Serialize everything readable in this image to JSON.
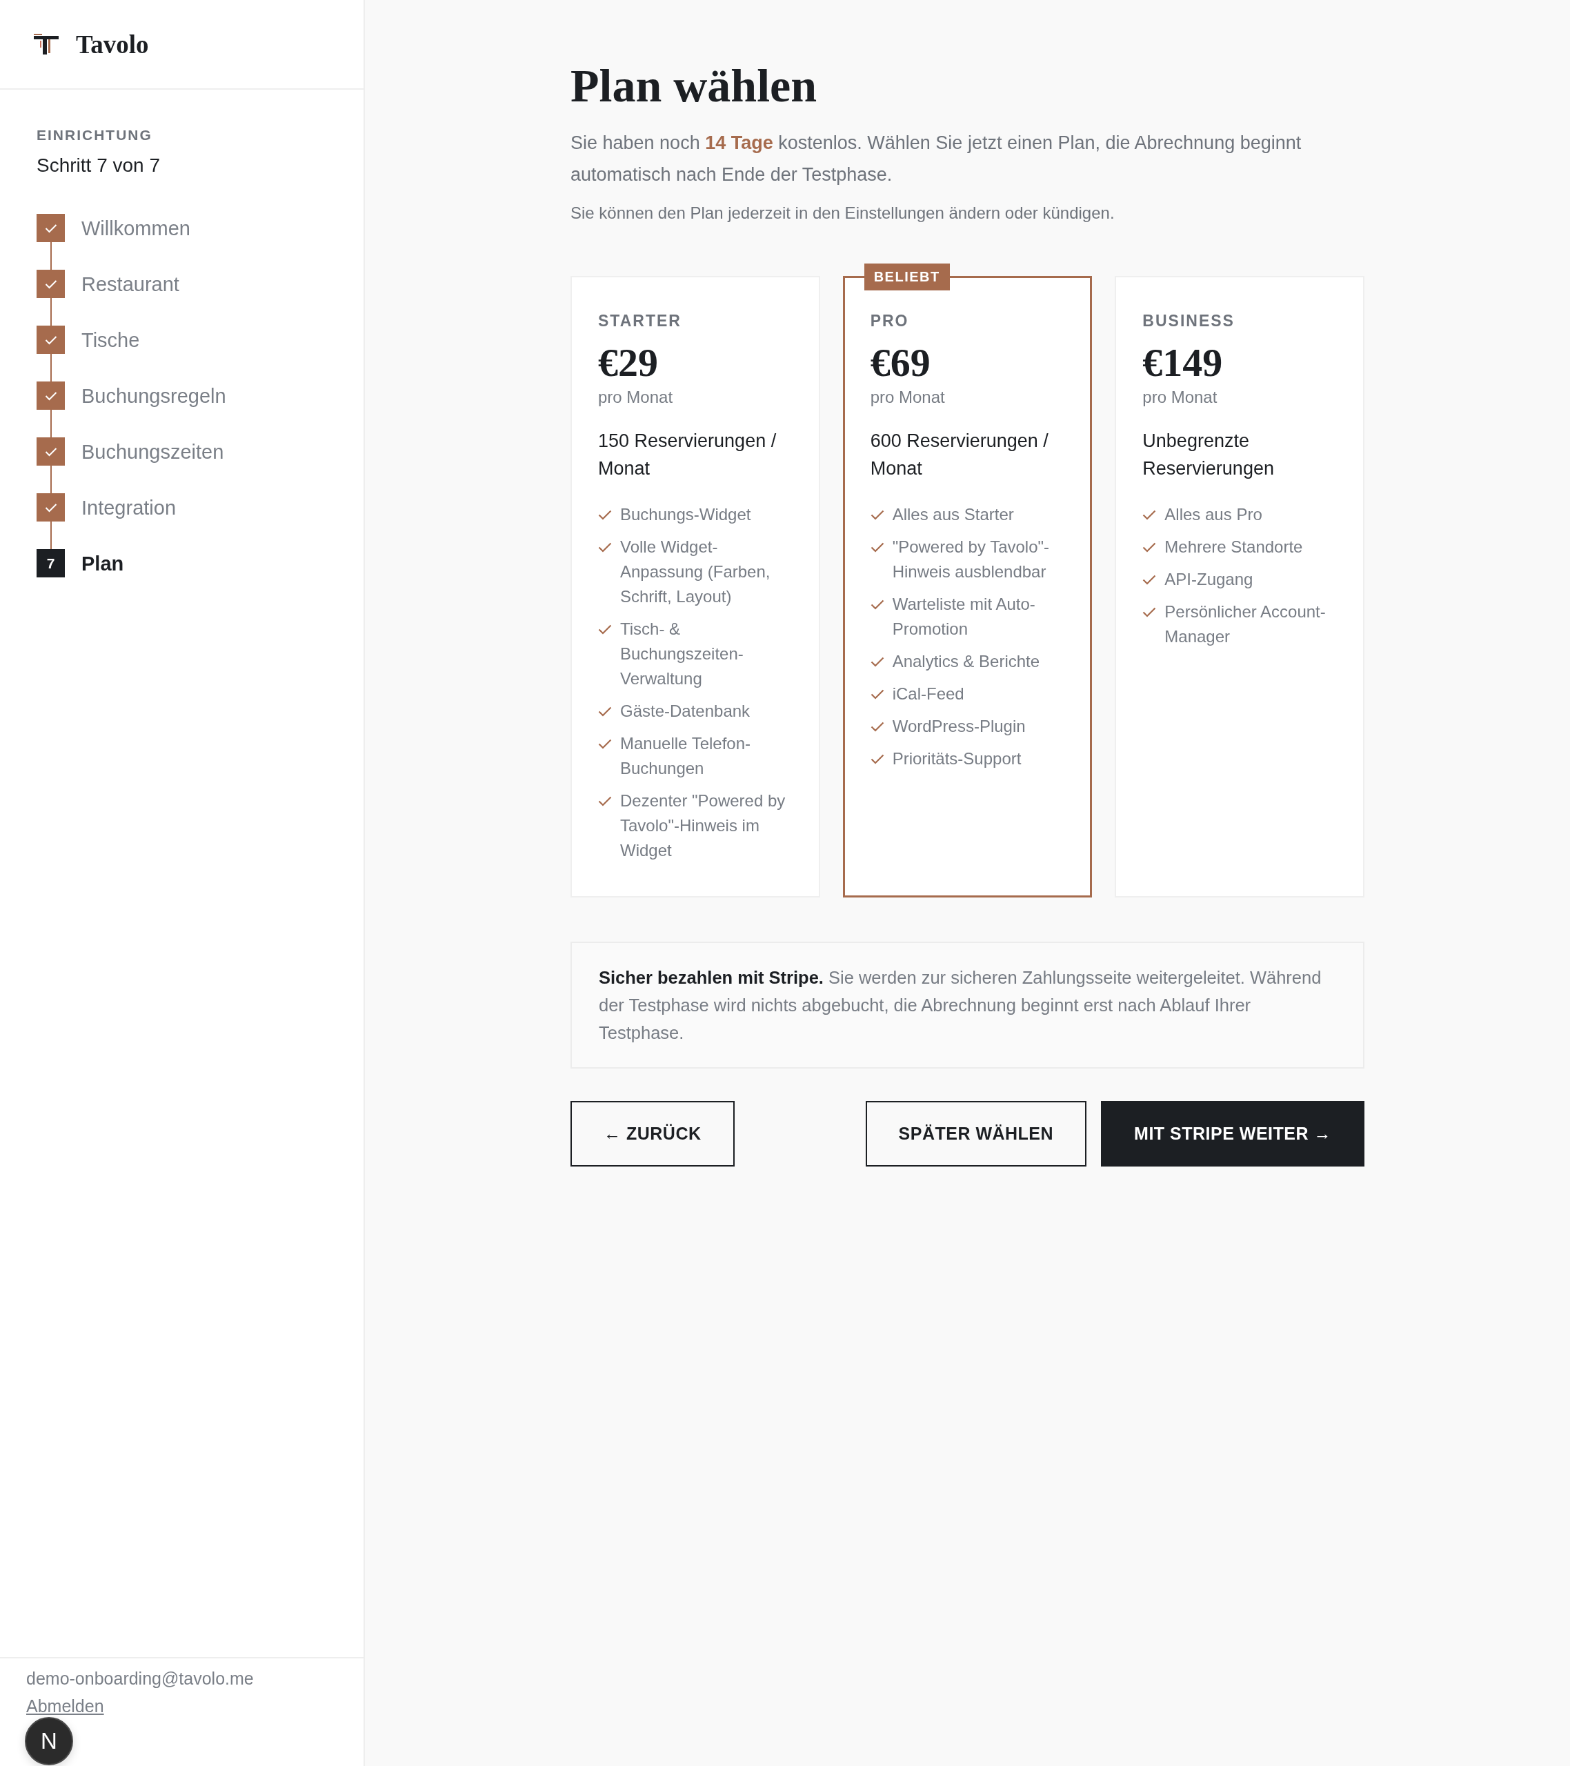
{
  "sidebar": {
    "brand": "Tavolo",
    "section_label": "EINRICHTUNG",
    "progress": "Schritt 7 von 7",
    "steps": [
      {
        "label": "Willkommen",
        "completed": true,
        "selected": false
      },
      {
        "label": "Restaurant",
        "completed": true,
        "selected": false
      },
      {
        "label": "Tische",
        "completed": true,
        "selected": false
      },
      {
        "label": "Buchungsregeln",
        "completed": true,
        "selected": false
      },
      {
        "label": "Buchungszeiten",
        "completed": true,
        "selected": false
      },
      {
        "label": "Integration",
        "completed": true,
        "selected": false
      },
      {
        "label": "Plan",
        "number": "7",
        "completed": false,
        "selected": true
      }
    ],
    "user": {
      "email": "demo-onboarding@tavolo.me",
      "logout": "Abmelden"
    }
  },
  "page": {
    "title": "Plan wählen",
    "intro": "Sie haben noch **14 Tage** kostenlos. Wählen Sie jetzt einen Plan, die Abrechnung beginnt automatisch nach Ende der Testphase.",
    "note": "Sie können den Plan jederzeit in den Einstellungen ändern oder kündigen."
  },
  "plans": [
    {
      "name": "STARTER",
      "price": "€29",
      "period": "pro Monat",
      "quota": "150 Reservierungen / Monat",
      "highlighted": false,
      "features": [
        "Buchungs-Widget",
        "Volle Widget-Anpassung (Farben, Schrift, Layout)",
        "Tisch- & Buchungszeiten-Verwaltung",
        "Gäste-Datenbank",
        "Manuelle Telefon-Buchungen",
        "Dezenter \"Powered by Tavolo\"-Hinweis im Widget"
      ]
    },
    {
      "name": "PRO",
      "price": "€69",
      "period": "pro Monat",
      "quota": "600 Reservierungen / Monat",
      "highlighted": true,
      "badge": "BELIEBT",
      "features": [
        "Alles aus Starter",
        "\"Powered by Tavolo\"-Hinweis ausblendbar",
        "Warteliste mit Auto-Promotion",
        "Analytics & Berichte",
        "iCal-Feed",
        "WordPress-Plugin",
        "Prioritäts-Support"
      ]
    },
    {
      "name": "BUSINESS",
      "price": "€149",
      "period": "pro Monat",
      "quota": "Unbegrenzte Reservierungen",
      "highlighted": false,
      "features": [
        "Alles aus Pro",
        "Mehrere Standorte",
        "API-Zugang",
        "Persönlicher Account-Manager"
      ]
    }
  ],
  "payment_notice": "**Sicher bezahlen mit Stripe.** Sie werden zur sicheren Zahlungsseite weitergeleitet. Während der Testphase wird nichts abgebucht, die Abrechnung beginnt erst nach Ablauf Ihrer Testphase.",
  "buttons": [
    {
      "label": "← ZURÜCK",
      "kind": "outline"
    },
    {
      "label": "SPÄTER WÄHLEN",
      "kind": "outline"
    },
    {
      "label": "MIT STRIPE WEITER →",
      "kind": "primary"
    }
  ],
  "dev_indicator": {
    "letter": "N"
  }
}
